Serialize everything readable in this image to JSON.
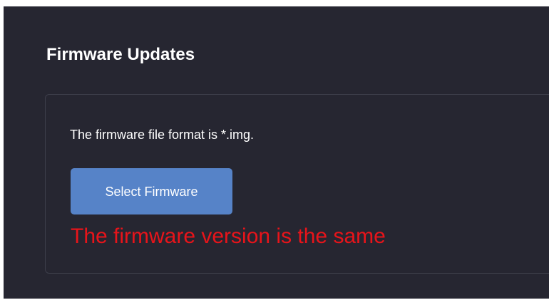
{
  "section": {
    "title": "Firmware Updates"
  },
  "card": {
    "format_note": "The firmware file format is *.img.",
    "select_button_label": "Select Firmware",
    "status_message": "The firmware version is the same"
  },
  "colors": {
    "panel_background": "#262631",
    "button_background": "#5683c8",
    "status_error": "#e8141a",
    "card_border": "#3e3f4b"
  }
}
